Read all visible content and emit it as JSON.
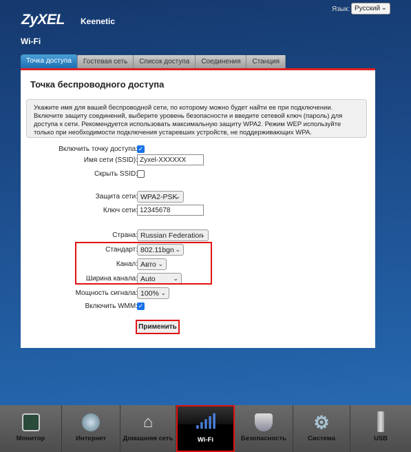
{
  "header": {
    "brand": "ZyXEL",
    "model": "Keenetic",
    "section": "Wi-Fi",
    "language_label": "Язык:",
    "language_value": "Русский"
  },
  "tabs": [
    {
      "label": "Точка доступа",
      "active": true
    },
    {
      "label": "Гостевая сеть"
    },
    {
      "label": "Список доступа"
    },
    {
      "label": "Соединения"
    },
    {
      "label": "Станция"
    }
  ],
  "panel": {
    "title": "Точка беспроводного доступа",
    "info": "Укажите имя для вашей беспроводной сети, по которому можно будет найти ее при подключении. Включите защиту соединений, выберите уровень безопасности и введите сетевой ключ (пароль) для доступа к сети. Рекомендуется использовать максимальную защиту WPA2. Режим WEP используйте только при необходимости подключения устаревших устройств, не поддерживающих WPA."
  },
  "form": {
    "enable_ap": {
      "label": "Включить точку доступа:",
      "checked": true
    },
    "ssid": {
      "label": "Имя сети (SSID):",
      "value": "Zyxel-XXXXXX"
    },
    "hide_ssid": {
      "label": "Скрыть SSID:",
      "checked": false
    },
    "security": {
      "label": "Защита сети:",
      "value": "WPA2-PSK"
    },
    "key": {
      "label": "Ключ сети:",
      "value": "12345678"
    },
    "country": {
      "label": "Страна:",
      "value": "Russian Federation"
    },
    "standard": {
      "label": "Стандарт:",
      "value": "802.11bgn"
    },
    "channel": {
      "label": "Канал:",
      "value": "Авто"
    },
    "width": {
      "label": "Ширина канала:",
      "value": "Auto"
    },
    "power": {
      "label": "Мощность сигнала:",
      "value": "100%"
    },
    "wmm": {
      "label": "Включить WMM:",
      "checked": true
    },
    "apply": "Применить"
  },
  "nav": [
    {
      "label": "Монитор",
      "icon": "monitor-icon"
    },
    {
      "label": "Интернет",
      "icon": "globe-icon"
    },
    {
      "label": "Домашняя сеть",
      "icon": "home-icon"
    },
    {
      "label": "Wi-Fi",
      "icon": "wifi-signal-icon",
      "active": true
    },
    {
      "label": "Безопасность",
      "icon": "shield-icon"
    },
    {
      "label": "Система",
      "icon": "gear-icon"
    },
    {
      "label": "USB",
      "icon": "usb-icon"
    }
  ],
  "colors": {
    "highlight": "#e01010",
    "active_tab": "#1c6fb0",
    "checkbox": "#1a73e8"
  }
}
